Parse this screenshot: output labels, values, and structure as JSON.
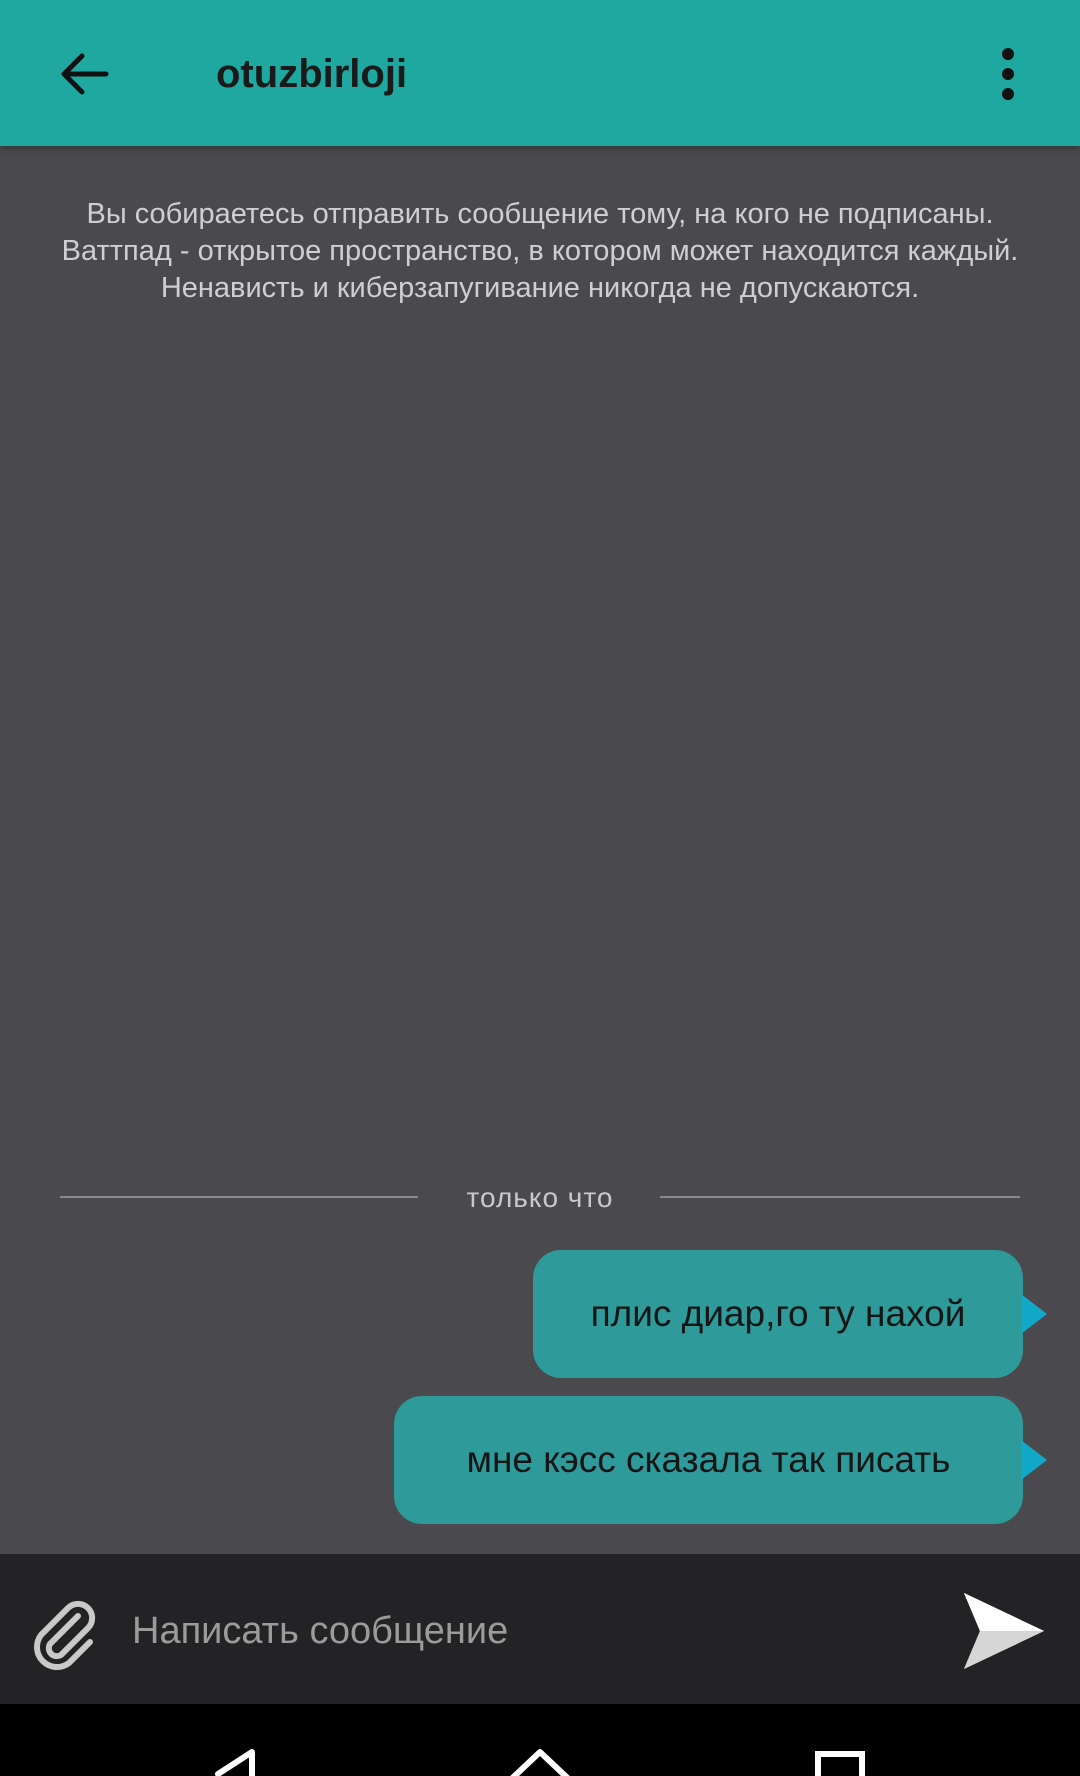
{
  "colors": {
    "toolbar": "#1fa8a0",
    "background": "#4a494d",
    "bubble": "#2e9a9a",
    "bubble_tail": "#11a9c7",
    "compose_bar": "#232224",
    "nav_bar": "#000000"
  },
  "toolbar": {
    "back_icon": "arrow-left-icon",
    "title": "otuzbirloji",
    "menu_icon": "more-vertical-icon"
  },
  "notice": {
    "text": "Вы собираетесь отправить сообщение тому, на кого не подписаны. Ваттпад - открытое пространство, в котором может находится каждый. Ненависть и киберзапугивание никогда не допускаются."
  },
  "timestamp": {
    "label": "только что"
  },
  "messages": [
    {
      "text": "плис диар,го ту нахой"
    },
    {
      "text": "мне кэсс сказала так писать"
    }
  ],
  "compose": {
    "attach_icon": "paperclip-icon",
    "placeholder": "Написать сообщение",
    "value": "",
    "send_icon": "send-icon"
  },
  "navbar": {
    "back_icon": "nav-back-icon",
    "home_icon": "nav-home-icon",
    "recents_icon": "nav-recents-icon"
  }
}
